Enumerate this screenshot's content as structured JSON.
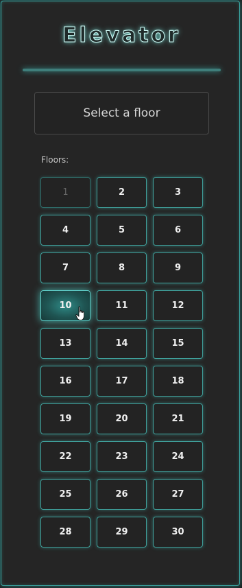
{
  "app": {
    "title": "Elevator"
  },
  "display": {
    "text": "Select a floor"
  },
  "floors": {
    "label": "Floors:",
    "buttons": [
      {
        "label": "1",
        "state": "disabled"
      },
      {
        "label": "2",
        "state": "normal"
      },
      {
        "label": "3",
        "state": "normal"
      },
      {
        "label": "4",
        "state": "normal"
      },
      {
        "label": "5",
        "state": "normal"
      },
      {
        "label": "6",
        "state": "normal"
      },
      {
        "label": "7",
        "state": "normal"
      },
      {
        "label": "8",
        "state": "normal"
      },
      {
        "label": "9",
        "state": "normal"
      },
      {
        "label": "10",
        "state": "hover"
      },
      {
        "label": "11",
        "state": "normal"
      },
      {
        "label": "12",
        "state": "normal"
      },
      {
        "label": "13",
        "state": "normal"
      },
      {
        "label": "14",
        "state": "normal"
      },
      {
        "label": "15",
        "state": "normal"
      },
      {
        "label": "16",
        "state": "normal"
      },
      {
        "label": "17",
        "state": "normal"
      },
      {
        "label": "18",
        "state": "normal"
      },
      {
        "label": "19",
        "state": "normal"
      },
      {
        "label": "20",
        "state": "normal"
      },
      {
        "label": "21",
        "state": "normal"
      },
      {
        "label": "22",
        "state": "normal"
      },
      {
        "label": "23",
        "state": "normal"
      },
      {
        "label": "24",
        "state": "normal"
      },
      {
        "label": "25",
        "state": "normal"
      },
      {
        "label": "26",
        "state": "normal"
      },
      {
        "label": "27",
        "state": "normal"
      },
      {
        "label": "28",
        "state": "normal"
      },
      {
        "label": "29",
        "state": "normal"
      },
      {
        "label": "30",
        "state": "normal"
      }
    ]
  },
  "colors": {
    "accent": "#3fbeb9",
    "panel_background": "#252525",
    "page_background": "#1b1b1b"
  },
  "icons": {
    "cursor": "pointer-hand-icon"
  }
}
